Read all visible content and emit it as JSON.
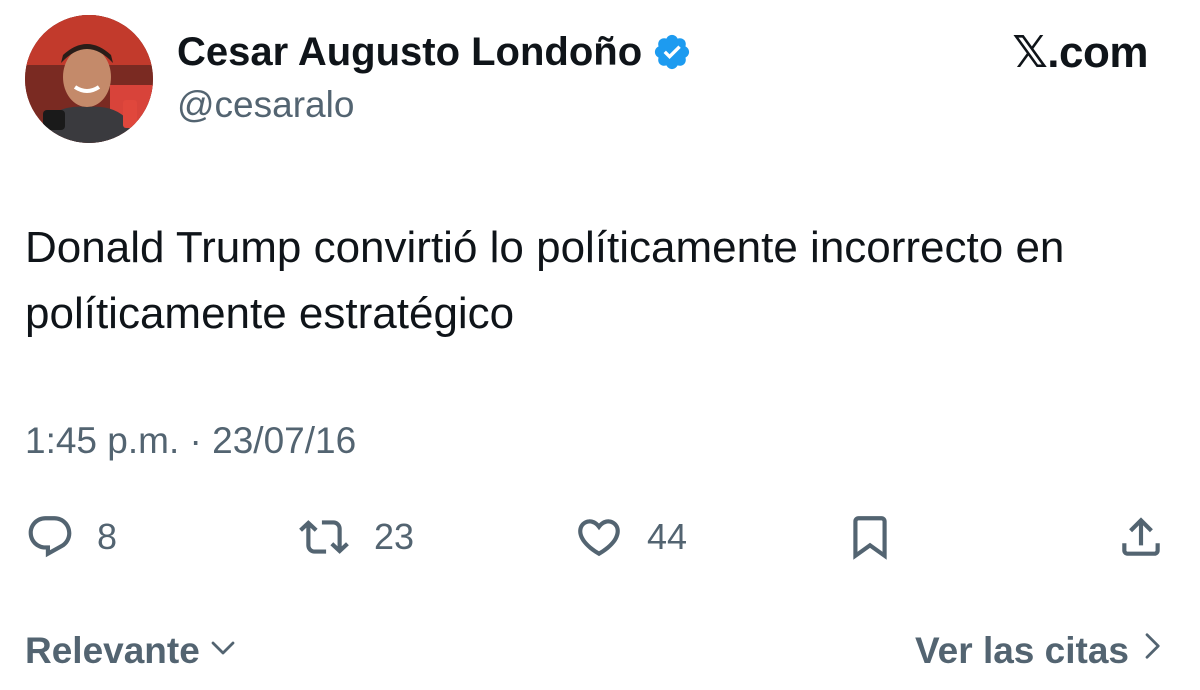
{
  "author": {
    "display_name": "Cesar Augusto Londoño",
    "handle": "@cesaralo",
    "verified_color": "#1d9bf0"
  },
  "brand": "𝕏.com",
  "tweet": {
    "text": "Donald Trump convirtió lo políticamente incorrecto en políticamente estratégico",
    "timestamp": "1:45 p.m. · 23/07/16"
  },
  "actions": {
    "replies": "8",
    "retweets": "23",
    "likes": "44"
  },
  "footer": {
    "sort_label": "Relevante",
    "quotes_label": "Ver las citas"
  },
  "colors": {
    "text": "#0f1419",
    "secondary": "#536471",
    "accent": "#1d9bf0"
  }
}
